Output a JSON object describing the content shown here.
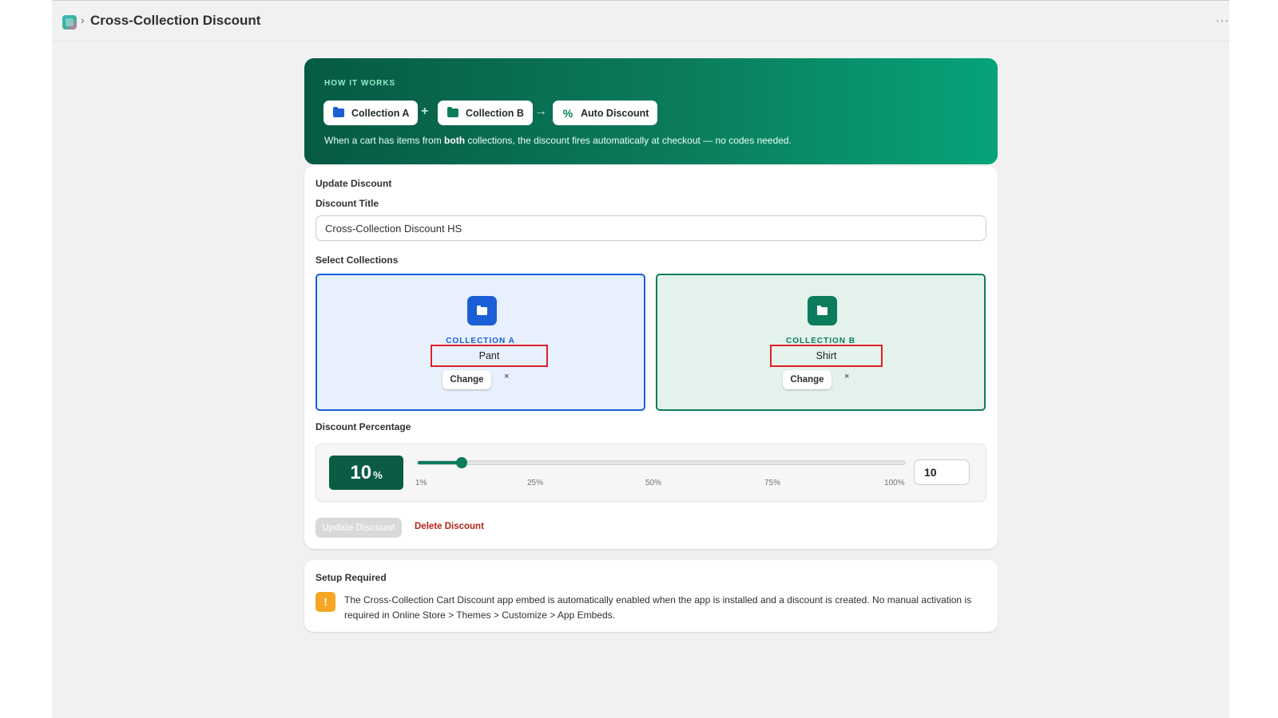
{
  "header": {
    "app_icon": "app-logo-icon",
    "separator": "›",
    "title": "Cross-Collection Discount",
    "more": "···"
  },
  "hero": {
    "kicker": "HOW IT WORKS",
    "chips": [
      {
        "label": "Collection A",
        "icon": "folder-icon",
        "color": "#1a5fd6"
      },
      {
        "label": "Collection B",
        "icon": "folder-icon",
        "color": "#0b7c5c"
      },
      {
        "label": "Auto Discount",
        "icon": "percent-icon",
        "color": "#0b7c5c"
      }
    ],
    "plus": "+",
    "arrow": "→",
    "desc_before": "When a cart has items from ",
    "desc_bold": "both",
    "desc_after": " collections, the discount fires automatically at checkout — no codes needed."
  },
  "form": {
    "section_title": "Update Discount",
    "title_label": "Discount Title",
    "title_value": "Cross-Collection Discount HS",
    "collections_label": "Select Collections",
    "collection_a": {
      "kicker": "COLLECTION A",
      "name": "Pant",
      "change": "Change",
      "remove": "×",
      "color": "#1a5fd6"
    },
    "collection_b": {
      "kicker": "COLLECTION B",
      "name": "Shirt",
      "change": "Change",
      "remove": "×",
      "color": "#0b7c5c"
    },
    "percentage_label": "Discount Percentage",
    "percentage": {
      "value": "10",
      "sign": "%",
      "min": 1,
      "max": 100,
      "ticks": [
        "1%",
        "25%",
        "50%",
        "75%",
        "100%"
      ]
    },
    "update_button": "Update Discount",
    "delete_link": "Delete Discount"
  },
  "setup": {
    "title": "Setup Required",
    "icon_glyph": "!",
    "text": "The Cross-Collection Cart Discount app embed is automatically enabled when the app is installed and a discount is created. No manual activation is required in Online Store > Themes > Customize > App Embeds."
  },
  "colors": {
    "accent_green": "#0b7c5c",
    "accent_blue": "#1a5fd6",
    "danger": "#b42318",
    "warning": "#f5a623",
    "highlight_box": "#e01f26"
  }
}
